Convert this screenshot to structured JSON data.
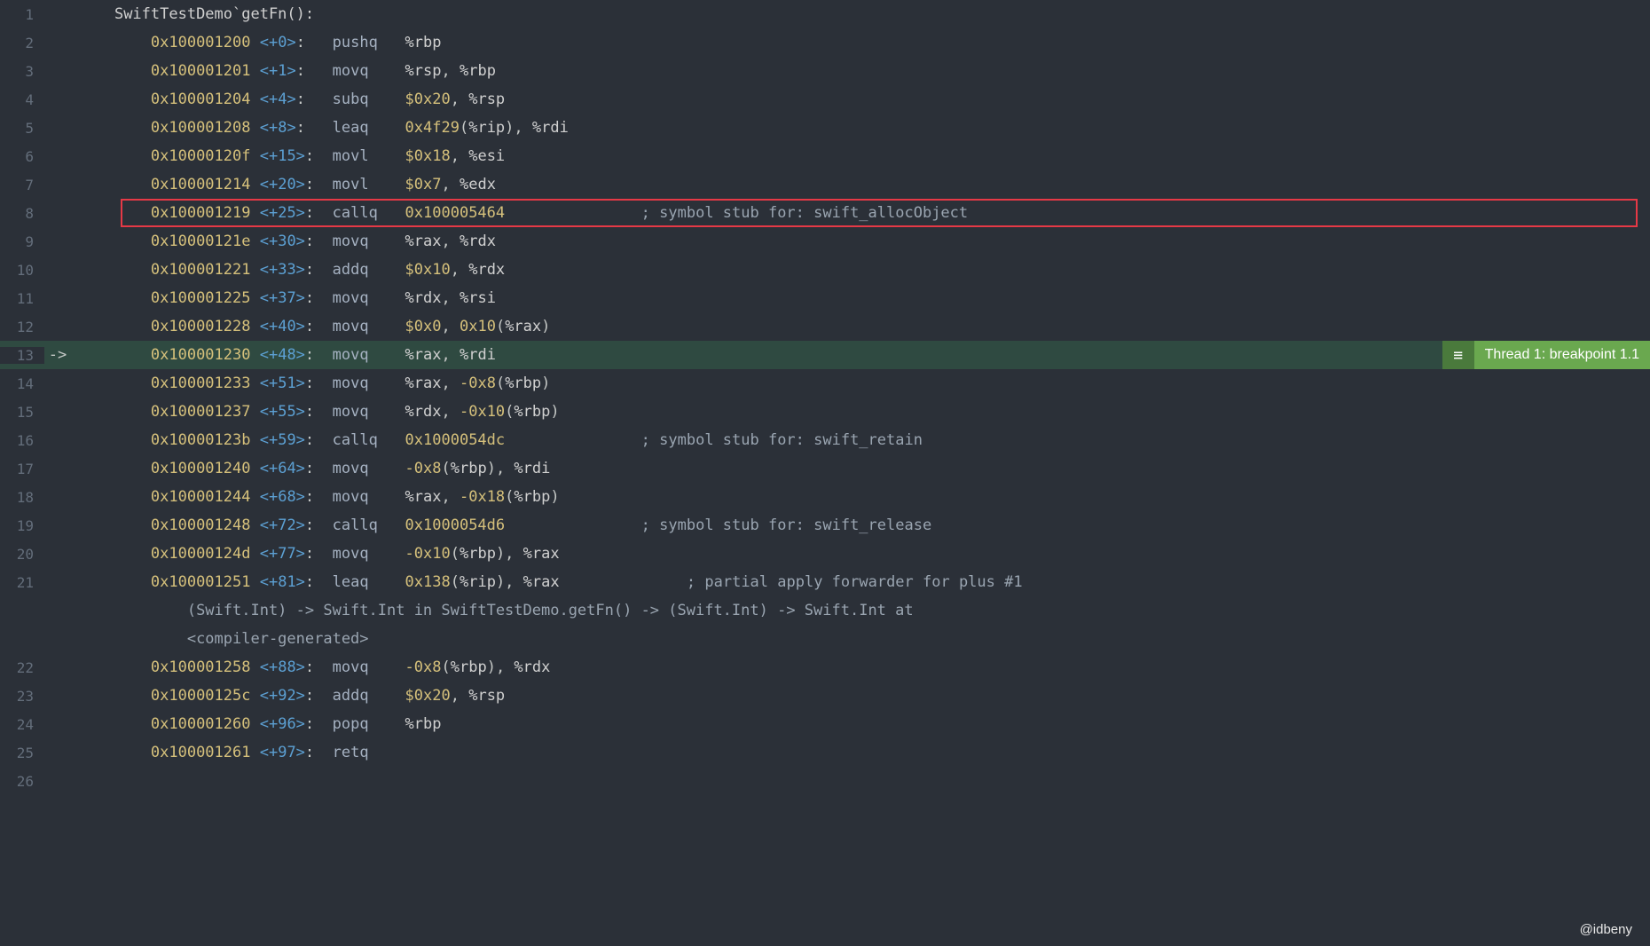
{
  "watermark": "@idbeny",
  "breakpoint_label": "Thread 1: breakpoint 1.1",
  "current_line_number": 13,
  "highlighted_line_number": 8,
  "lines": [
    {
      "num": 1,
      "arrow": "",
      "indent": "    ",
      "tokens": [
        {
          "t": "func-header",
          "v": "SwiftTestDemo`getFn():"
        }
      ]
    },
    {
      "num": 2,
      "arrow": "",
      "indent": "        ",
      "tokens": [
        {
          "t": "addr",
          "v": "0x100001200"
        },
        {
          "t": "plain",
          "v": " "
        },
        {
          "t": "offset",
          "v": "<+0>"
        },
        {
          "t": "plain",
          "v": ":   "
        },
        {
          "t": "mnemonic",
          "v": "pushq"
        },
        {
          "t": "plain",
          "v": "   "
        },
        {
          "t": "reg",
          "v": "%rbp"
        }
      ]
    },
    {
      "num": 3,
      "arrow": "",
      "indent": "        ",
      "tokens": [
        {
          "t": "addr",
          "v": "0x100001201"
        },
        {
          "t": "plain",
          "v": " "
        },
        {
          "t": "offset",
          "v": "<+1>"
        },
        {
          "t": "plain",
          "v": ":   "
        },
        {
          "t": "mnemonic",
          "v": "movq"
        },
        {
          "t": "plain",
          "v": "    "
        },
        {
          "t": "reg",
          "v": "%rsp"
        },
        {
          "t": "plain",
          "v": ", "
        },
        {
          "t": "reg",
          "v": "%rbp"
        }
      ]
    },
    {
      "num": 4,
      "arrow": "",
      "indent": "        ",
      "tokens": [
        {
          "t": "addr",
          "v": "0x100001204"
        },
        {
          "t": "plain",
          "v": " "
        },
        {
          "t": "offset",
          "v": "<+4>"
        },
        {
          "t": "plain",
          "v": ":   "
        },
        {
          "t": "mnemonic",
          "v": "subq"
        },
        {
          "t": "plain",
          "v": "    "
        },
        {
          "t": "literal",
          "v": "$0x20"
        },
        {
          "t": "plain",
          "v": ", "
        },
        {
          "t": "reg",
          "v": "%rsp"
        }
      ]
    },
    {
      "num": 5,
      "arrow": "",
      "indent": "        ",
      "tokens": [
        {
          "t": "addr",
          "v": "0x100001208"
        },
        {
          "t": "plain",
          "v": " "
        },
        {
          "t": "offset",
          "v": "<+8>"
        },
        {
          "t": "plain",
          "v": ":   "
        },
        {
          "t": "mnemonic",
          "v": "leaq"
        },
        {
          "t": "plain",
          "v": "    "
        },
        {
          "t": "literal",
          "v": "0x4f29"
        },
        {
          "t": "plain",
          "v": "("
        },
        {
          "t": "reg",
          "v": "%rip"
        },
        {
          "t": "plain",
          "v": "), "
        },
        {
          "t": "reg",
          "v": "%rdi"
        }
      ]
    },
    {
      "num": 6,
      "arrow": "",
      "indent": "        ",
      "tokens": [
        {
          "t": "addr",
          "v": "0x10000120f"
        },
        {
          "t": "plain",
          "v": " "
        },
        {
          "t": "offset",
          "v": "<+15>"
        },
        {
          "t": "plain",
          "v": ":  "
        },
        {
          "t": "mnemonic",
          "v": "movl"
        },
        {
          "t": "plain",
          "v": "    "
        },
        {
          "t": "literal",
          "v": "$0x18"
        },
        {
          "t": "plain",
          "v": ", "
        },
        {
          "t": "reg",
          "v": "%esi"
        }
      ]
    },
    {
      "num": 7,
      "arrow": "",
      "indent": "        ",
      "tokens": [
        {
          "t": "addr",
          "v": "0x100001214"
        },
        {
          "t": "plain",
          "v": " "
        },
        {
          "t": "offset",
          "v": "<+20>"
        },
        {
          "t": "plain",
          "v": ":  "
        },
        {
          "t": "mnemonic",
          "v": "movl"
        },
        {
          "t": "plain",
          "v": "    "
        },
        {
          "t": "literal",
          "v": "$0x7"
        },
        {
          "t": "plain",
          "v": ", "
        },
        {
          "t": "reg",
          "v": "%edx"
        }
      ]
    },
    {
      "num": 8,
      "arrow": "",
      "indent": "        ",
      "tokens": [
        {
          "t": "addr",
          "v": "0x100001219"
        },
        {
          "t": "plain",
          "v": " "
        },
        {
          "t": "offset",
          "v": "<+25>"
        },
        {
          "t": "plain",
          "v": ":  "
        },
        {
          "t": "mnemonic",
          "v": "callq"
        },
        {
          "t": "plain",
          "v": "   "
        },
        {
          "t": "literal",
          "v": "0x100005464"
        },
        {
          "t": "plain",
          "v": "               "
        },
        {
          "t": "comment",
          "v": "; symbol stub for: swift_allocObject"
        }
      ]
    },
    {
      "num": 9,
      "arrow": "",
      "indent": "        ",
      "tokens": [
        {
          "t": "addr",
          "v": "0x10000121e"
        },
        {
          "t": "plain",
          "v": " "
        },
        {
          "t": "offset",
          "v": "<+30>"
        },
        {
          "t": "plain",
          "v": ":  "
        },
        {
          "t": "mnemonic",
          "v": "movq"
        },
        {
          "t": "plain",
          "v": "    "
        },
        {
          "t": "reg",
          "v": "%rax"
        },
        {
          "t": "plain",
          "v": ", "
        },
        {
          "t": "reg",
          "v": "%rdx"
        }
      ]
    },
    {
      "num": 10,
      "arrow": "",
      "indent": "        ",
      "tokens": [
        {
          "t": "addr",
          "v": "0x100001221"
        },
        {
          "t": "plain",
          "v": " "
        },
        {
          "t": "offset",
          "v": "<+33>"
        },
        {
          "t": "plain",
          "v": ":  "
        },
        {
          "t": "mnemonic",
          "v": "addq"
        },
        {
          "t": "plain",
          "v": "    "
        },
        {
          "t": "literal",
          "v": "$0x10"
        },
        {
          "t": "plain",
          "v": ", "
        },
        {
          "t": "reg",
          "v": "%rdx"
        }
      ]
    },
    {
      "num": 11,
      "arrow": "",
      "indent": "        ",
      "tokens": [
        {
          "t": "addr",
          "v": "0x100001225"
        },
        {
          "t": "plain",
          "v": " "
        },
        {
          "t": "offset",
          "v": "<+37>"
        },
        {
          "t": "plain",
          "v": ":  "
        },
        {
          "t": "mnemonic",
          "v": "movq"
        },
        {
          "t": "plain",
          "v": "    "
        },
        {
          "t": "reg",
          "v": "%rdx"
        },
        {
          "t": "plain",
          "v": ", "
        },
        {
          "t": "reg",
          "v": "%rsi"
        }
      ]
    },
    {
      "num": 12,
      "arrow": "",
      "indent": "        ",
      "tokens": [
        {
          "t": "addr",
          "v": "0x100001228"
        },
        {
          "t": "plain",
          "v": " "
        },
        {
          "t": "offset",
          "v": "<+40>"
        },
        {
          "t": "plain",
          "v": ":  "
        },
        {
          "t": "mnemonic",
          "v": "movq"
        },
        {
          "t": "plain",
          "v": "    "
        },
        {
          "t": "literal",
          "v": "$0x0"
        },
        {
          "t": "plain",
          "v": ", "
        },
        {
          "t": "literal",
          "v": "0x10"
        },
        {
          "t": "plain",
          "v": "("
        },
        {
          "t": "reg",
          "v": "%rax"
        },
        {
          "t": "plain",
          "v": ")"
        }
      ]
    },
    {
      "num": 13,
      "arrow": "->",
      "indent": "        ",
      "tokens": [
        {
          "t": "addr",
          "v": "0x100001230"
        },
        {
          "t": "plain",
          "v": " "
        },
        {
          "t": "offset",
          "v": "<+48>"
        },
        {
          "t": "plain",
          "v": ":  "
        },
        {
          "t": "mnemonic",
          "v": "movq"
        },
        {
          "t": "plain",
          "v": "    "
        },
        {
          "t": "reg",
          "v": "%rax"
        },
        {
          "t": "plain",
          "v": ", "
        },
        {
          "t": "reg",
          "v": "%rdi"
        }
      ]
    },
    {
      "num": 14,
      "arrow": "",
      "indent": "        ",
      "tokens": [
        {
          "t": "addr",
          "v": "0x100001233"
        },
        {
          "t": "plain",
          "v": " "
        },
        {
          "t": "offset",
          "v": "<+51>"
        },
        {
          "t": "plain",
          "v": ":  "
        },
        {
          "t": "mnemonic",
          "v": "movq"
        },
        {
          "t": "plain",
          "v": "    "
        },
        {
          "t": "reg",
          "v": "%rax"
        },
        {
          "t": "plain",
          "v": ", "
        },
        {
          "t": "literal",
          "v": "-0x8"
        },
        {
          "t": "plain",
          "v": "("
        },
        {
          "t": "reg",
          "v": "%rbp"
        },
        {
          "t": "plain",
          "v": ")"
        }
      ]
    },
    {
      "num": 15,
      "arrow": "",
      "indent": "        ",
      "tokens": [
        {
          "t": "addr",
          "v": "0x100001237"
        },
        {
          "t": "plain",
          "v": " "
        },
        {
          "t": "offset",
          "v": "<+55>"
        },
        {
          "t": "plain",
          "v": ":  "
        },
        {
          "t": "mnemonic",
          "v": "movq"
        },
        {
          "t": "plain",
          "v": "    "
        },
        {
          "t": "reg",
          "v": "%rdx"
        },
        {
          "t": "plain",
          "v": ", "
        },
        {
          "t": "literal",
          "v": "-0x10"
        },
        {
          "t": "plain",
          "v": "("
        },
        {
          "t": "reg",
          "v": "%rbp"
        },
        {
          "t": "plain",
          "v": ")"
        }
      ]
    },
    {
      "num": 16,
      "arrow": "",
      "indent": "        ",
      "tokens": [
        {
          "t": "addr",
          "v": "0x10000123b"
        },
        {
          "t": "plain",
          "v": " "
        },
        {
          "t": "offset",
          "v": "<+59>"
        },
        {
          "t": "plain",
          "v": ":  "
        },
        {
          "t": "mnemonic",
          "v": "callq"
        },
        {
          "t": "plain",
          "v": "   "
        },
        {
          "t": "literal",
          "v": "0x1000054dc"
        },
        {
          "t": "plain",
          "v": "               "
        },
        {
          "t": "comment",
          "v": "; symbol stub for: swift_retain"
        }
      ]
    },
    {
      "num": 17,
      "arrow": "",
      "indent": "        ",
      "tokens": [
        {
          "t": "addr",
          "v": "0x100001240"
        },
        {
          "t": "plain",
          "v": " "
        },
        {
          "t": "offset",
          "v": "<+64>"
        },
        {
          "t": "plain",
          "v": ":  "
        },
        {
          "t": "mnemonic",
          "v": "movq"
        },
        {
          "t": "plain",
          "v": "    "
        },
        {
          "t": "literal",
          "v": "-0x8"
        },
        {
          "t": "plain",
          "v": "("
        },
        {
          "t": "reg",
          "v": "%rbp"
        },
        {
          "t": "plain",
          "v": "), "
        },
        {
          "t": "reg",
          "v": "%rdi"
        }
      ]
    },
    {
      "num": 18,
      "arrow": "",
      "indent": "        ",
      "tokens": [
        {
          "t": "addr",
          "v": "0x100001244"
        },
        {
          "t": "plain",
          "v": " "
        },
        {
          "t": "offset",
          "v": "<+68>"
        },
        {
          "t": "plain",
          "v": ":  "
        },
        {
          "t": "mnemonic",
          "v": "movq"
        },
        {
          "t": "plain",
          "v": "    "
        },
        {
          "t": "reg",
          "v": "%rax"
        },
        {
          "t": "plain",
          "v": ", "
        },
        {
          "t": "literal",
          "v": "-0x18"
        },
        {
          "t": "plain",
          "v": "("
        },
        {
          "t": "reg",
          "v": "%rbp"
        },
        {
          "t": "plain",
          "v": ")"
        }
      ]
    },
    {
      "num": 19,
      "arrow": "",
      "indent": "        ",
      "tokens": [
        {
          "t": "addr",
          "v": "0x100001248"
        },
        {
          "t": "plain",
          "v": " "
        },
        {
          "t": "offset",
          "v": "<+72>"
        },
        {
          "t": "plain",
          "v": ":  "
        },
        {
          "t": "mnemonic",
          "v": "callq"
        },
        {
          "t": "plain",
          "v": "   "
        },
        {
          "t": "literal",
          "v": "0x1000054d6"
        },
        {
          "t": "plain",
          "v": "               "
        },
        {
          "t": "comment",
          "v": "; symbol stub for: swift_release"
        }
      ]
    },
    {
      "num": 20,
      "arrow": "",
      "indent": "        ",
      "tokens": [
        {
          "t": "addr",
          "v": "0x10000124d"
        },
        {
          "t": "plain",
          "v": " "
        },
        {
          "t": "offset",
          "v": "<+77>"
        },
        {
          "t": "plain",
          "v": ":  "
        },
        {
          "t": "mnemonic",
          "v": "movq"
        },
        {
          "t": "plain",
          "v": "    "
        },
        {
          "t": "literal",
          "v": "-0x10"
        },
        {
          "t": "plain",
          "v": "("
        },
        {
          "t": "reg",
          "v": "%rbp"
        },
        {
          "t": "plain",
          "v": "), "
        },
        {
          "t": "reg",
          "v": "%rax"
        }
      ]
    },
    {
      "num": 21,
      "arrow": "",
      "indent": "        ",
      "tokens": [
        {
          "t": "addr",
          "v": "0x100001251"
        },
        {
          "t": "plain",
          "v": " "
        },
        {
          "t": "offset",
          "v": "<+81>"
        },
        {
          "t": "plain",
          "v": ":  "
        },
        {
          "t": "mnemonic",
          "v": "leaq"
        },
        {
          "t": "plain",
          "v": "    "
        },
        {
          "t": "literal",
          "v": "0x138"
        },
        {
          "t": "plain",
          "v": "("
        },
        {
          "t": "reg",
          "v": "%rip"
        },
        {
          "t": "plain",
          "v": "), "
        },
        {
          "t": "reg",
          "v": "%rax"
        },
        {
          "t": "plain",
          "v": "              "
        },
        {
          "t": "comment",
          "v": "; partial apply forwarder for plus #1 "
        }
      ]
    },
    {
      "num": "",
      "arrow": "",
      "indent": "            ",
      "tokens": [
        {
          "t": "note",
          "v": "(Swift.Int) -> Swift.Int in SwiftTestDemo.getFn() -> (Swift.Int) -> Swift.Int at "
        }
      ]
    },
    {
      "num": "",
      "arrow": "",
      "indent": "            ",
      "tokens": [
        {
          "t": "note",
          "v": "<compiler-generated>"
        }
      ]
    },
    {
      "num": 22,
      "arrow": "",
      "indent": "        ",
      "tokens": [
        {
          "t": "addr",
          "v": "0x100001258"
        },
        {
          "t": "plain",
          "v": " "
        },
        {
          "t": "offset",
          "v": "<+88>"
        },
        {
          "t": "plain",
          "v": ":  "
        },
        {
          "t": "mnemonic",
          "v": "movq"
        },
        {
          "t": "plain",
          "v": "    "
        },
        {
          "t": "literal",
          "v": "-0x8"
        },
        {
          "t": "plain",
          "v": "("
        },
        {
          "t": "reg",
          "v": "%rbp"
        },
        {
          "t": "plain",
          "v": "), "
        },
        {
          "t": "reg",
          "v": "%rdx"
        }
      ]
    },
    {
      "num": 23,
      "arrow": "",
      "indent": "        ",
      "tokens": [
        {
          "t": "addr",
          "v": "0x10000125c"
        },
        {
          "t": "plain",
          "v": " "
        },
        {
          "t": "offset",
          "v": "<+92>"
        },
        {
          "t": "plain",
          "v": ":  "
        },
        {
          "t": "mnemonic",
          "v": "addq"
        },
        {
          "t": "plain",
          "v": "    "
        },
        {
          "t": "literal",
          "v": "$0x20"
        },
        {
          "t": "plain",
          "v": ", "
        },
        {
          "t": "reg",
          "v": "%rsp"
        }
      ]
    },
    {
      "num": 24,
      "arrow": "",
      "indent": "        ",
      "tokens": [
        {
          "t": "addr",
          "v": "0x100001260"
        },
        {
          "t": "plain",
          "v": " "
        },
        {
          "t": "offset",
          "v": "<+96>"
        },
        {
          "t": "plain",
          "v": ":  "
        },
        {
          "t": "mnemonic",
          "v": "popq"
        },
        {
          "t": "plain",
          "v": "    "
        },
        {
          "t": "reg",
          "v": "%rbp"
        }
      ]
    },
    {
      "num": 25,
      "arrow": "",
      "indent": "        ",
      "tokens": [
        {
          "t": "addr",
          "v": "0x100001261"
        },
        {
          "t": "plain",
          "v": " "
        },
        {
          "t": "offset",
          "v": "<+97>"
        },
        {
          "t": "plain",
          "v": ":  "
        },
        {
          "t": "mnemonic",
          "v": "retq"
        }
      ]
    },
    {
      "num": 26,
      "arrow": "",
      "indent": "",
      "tokens": []
    }
  ]
}
